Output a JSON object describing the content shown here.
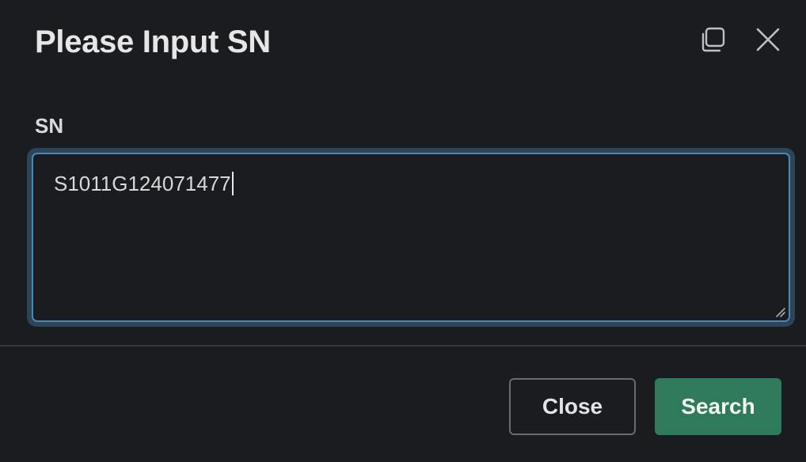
{
  "dialog": {
    "title": "Please Input SN",
    "actions": {
      "restore_icon": "restore-window-icon",
      "close_icon": "close-icon"
    }
  },
  "form": {
    "sn_label": "SN",
    "sn_value": "S1011G124071477"
  },
  "footer": {
    "close_label": "Close",
    "search_label": "Search"
  },
  "colors": {
    "background": "#1b1c20",
    "focus_border": "#4b87b5",
    "primary_button": "#2f7a5b"
  }
}
